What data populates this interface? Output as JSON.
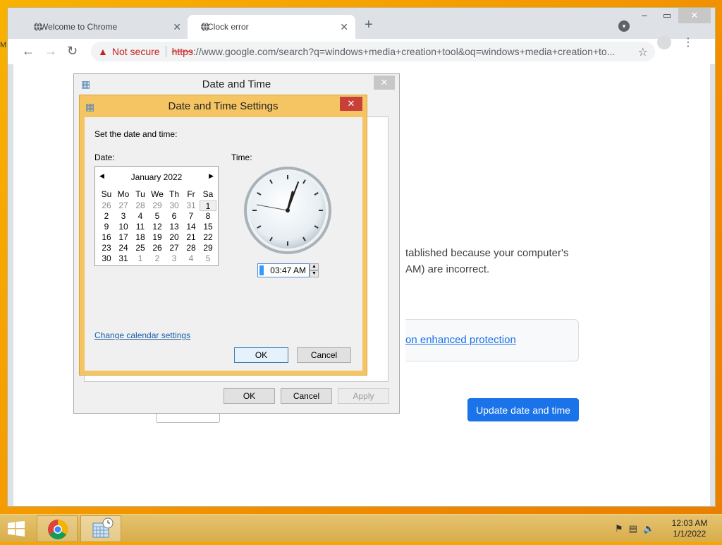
{
  "browser": {
    "tabs": [
      {
        "title": "Welcome to Chrome",
        "close": "✕"
      },
      {
        "title": "Clock error",
        "close": "✕"
      }
    ],
    "new_tab": "+",
    "window_controls": {
      "minimize": "–",
      "maximize": "▭",
      "close": "✕"
    },
    "nav": {
      "back": "←",
      "forward": "→",
      "reload": "↻"
    },
    "omnibox": {
      "warning_icon": "▲",
      "security_label": "Not secure",
      "url_scheme": "https",
      "url_rest": "://www.google.com/search?q=windows+media+creation+tool&oq=windows+media+creation+to..."
    },
    "star": "☆",
    "menu": "⋮"
  },
  "page": {
    "edge_fragment": "M",
    "body_text_line1": "tablished because your computer's",
    "body_text_line2": "AM) are incorrect.",
    "enhanced_link": "on enhanced protection",
    "update_button": "Update date and time"
  },
  "date_time_dialog": {
    "title": "Date and Time",
    "close": "✕",
    "buttons": {
      "ok": "OK",
      "cancel": "Cancel",
      "apply": "Apply"
    }
  },
  "date_time_settings": {
    "title": "Date and Time Settings",
    "close": "✕",
    "prompt": "Set the date and time:",
    "date_label": "Date:",
    "time_label": "Time:",
    "calendar": {
      "month_label": "January 2022",
      "prev": "◀",
      "next": "▶",
      "weekdays": [
        "Su",
        "Mo",
        "Tu",
        "We",
        "Th",
        "Fr",
        "Sa"
      ],
      "days": [
        {
          "d": "26",
          "other": true
        },
        {
          "d": "27",
          "other": true
        },
        {
          "d": "28",
          "other": true
        },
        {
          "d": "29",
          "other": true
        },
        {
          "d": "30",
          "other": true
        },
        {
          "d": "31",
          "other": true
        },
        {
          "d": "1",
          "selected": true
        },
        {
          "d": "2"
        },
        {
          "d": "3"
        },
        {
          "d": "4"
        },
        {
          "d": "5"
        },
        {
          "d": "6"
        },
        {
          "d": "7"
        },
        {
          "d": "8"
        },
        {
          "d": "9"
        },
        {
          "d": "10"
        },
        {
          "d": "11"
        },
        {
          "d": "12"
        },
        {
          "d": "13"
        },
        {
          "d": "14"
        },
        {
          "d": "15"
        },
        {
          "d": "16"
        },
        {
          "d": "17"
        },
        {
          "d": "18"
        },
        {
          "d": "19"
        },
        {
          "d": "20"
        },
        {
          "d": "21"
        },
        {
          "d": "22"
        },
        {
          "d": "23"
        },
        {
          "d": "24"
        },
        {
          "d": "25"
        },
        {
          "d": "26"
        },
        {
          "d": "27"
        },
        {
          "d": "28"
        },
        {
          "d": "29"
        },
        {
          "d": "30"
        },
        {
          "d": "31"
        },
        {
          "d": "1",
          "other": true
        },
        {
          "d": "2",
          "other": true
        },
        {
          "d": "3",
          "other": true
        },
        {
          "d": "4",
          "other": true
        },
        {
          "d": "5",
          "other": true
        }
      ]
    },
    "time_value": "03:47 AM",
    "spin_up": "▲",
    "spin_down": "▼",
    "change_calendar_link": "Change calendar settings",
    "buttons": {
      "ok": "OK",
      "cancel": "Cancel"
    }
  },
  "taskbar": {
    "clock_time": "12:03 AM",
    "clock_date": "1/1/2022"
  }
}
